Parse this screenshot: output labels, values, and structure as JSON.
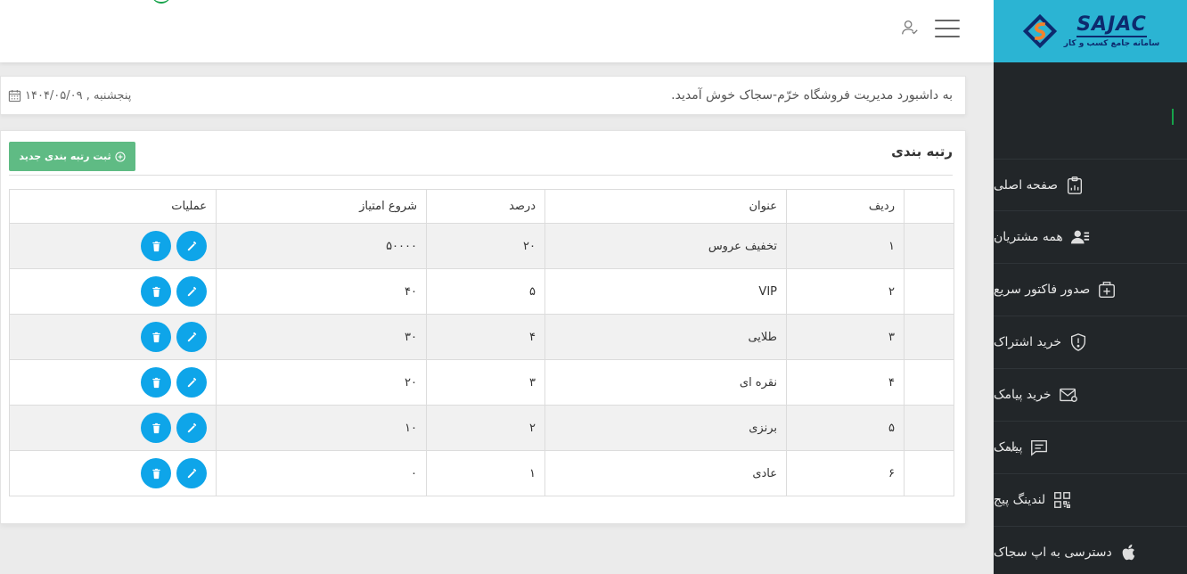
{
  "brand": {
    "name": "SAJAC",
    "subtitle": "سامانه جامع کسب و کار",
    "colors": {
      "header_bg": "#2bb4d3",
      "sidebar_bg": "#222629",
      "accent_green": "#5fbb84",
      "action_blue": "#0ea5e9"
    }
  },
  "header": {
    "menu_icon": "hamburger-icon",
    "user_icon": "user-check-icon"
  },
  "welcome": {
    "message": "به داشبورد مدیریت فروشگاه خرّم-سجاک خوش آمدید.",
    "date": "پنجشنبه , ۱۴۰۴/۰۵/۰۹",
    "date_icon": "calendar-icon"
  },
  "sidebar": {
    "items": [
      {
        "label": "صفحه اصلی",
        "icon": "dashboard-clipboard-icon"
      },
      {
        "label": "همه مشتریان",
        "icon": "users-list-icon"
      },
      {
        "label": "صدور فاکتور سریع",
        "icon": "invoice-add-icon"
      },
      {
        "label": "خرید اشتراک",
        "icon": "shield-alert-icon"
      },
      {
        "label": "خرید پیامک",
        "icon": "mail-settings-icon"
      },
      {
        "label": "پیامک",
        "icon": "chat-icon",
        "expandable": true
      },
      {
        "label": "لندینگ پیج",
        "icon": "qr-code-icon"
      },
      {
        "label": "دسترسی به اپ سجاک",
        "icon": "apple-icon"
      }
    ]
  },
  "page": {
    "title": "رتبه بندی",
    "add_button": "ثبت رتبه بندی جدید"
  },
  "table": {
    "columns": [
      "ردیف",
      "عنوان",
      "درصد",
      "شروع امتیاز",
      "عملیات"
    ],
    "rows": [
      {
        "index": "۱",
        "title": "تخفیف عروس",
        "percent": "۲۰",
        "start": "۵۰۰۰۰"
      },
      {
        "index": "۲",
        "title": "VIP",
        "percent": "۵",
        "start": "۴۰"
      },
      {
        "index": "۳",
        "title": "طلایی",
        "percent": "۴",
        "start": "۳۰"
      },
      {
        "index": "۴",
        "title": "نقره ای",
        "percent": "۳",
        "start": "۲۰"
      },
      {
        "index": "۵",
        "title": "برنزی",
        "percent": "۲",
        "start": "۱۰"
      },
      {
        "index": "۶",
        "title": "عادی",
        "percent": "۱",
        "start": "۰"
      }
    ],
    "row_actions": {
      "edit": "pencil-icon",
      "delete": "trash-icon"
    }
  }
}
